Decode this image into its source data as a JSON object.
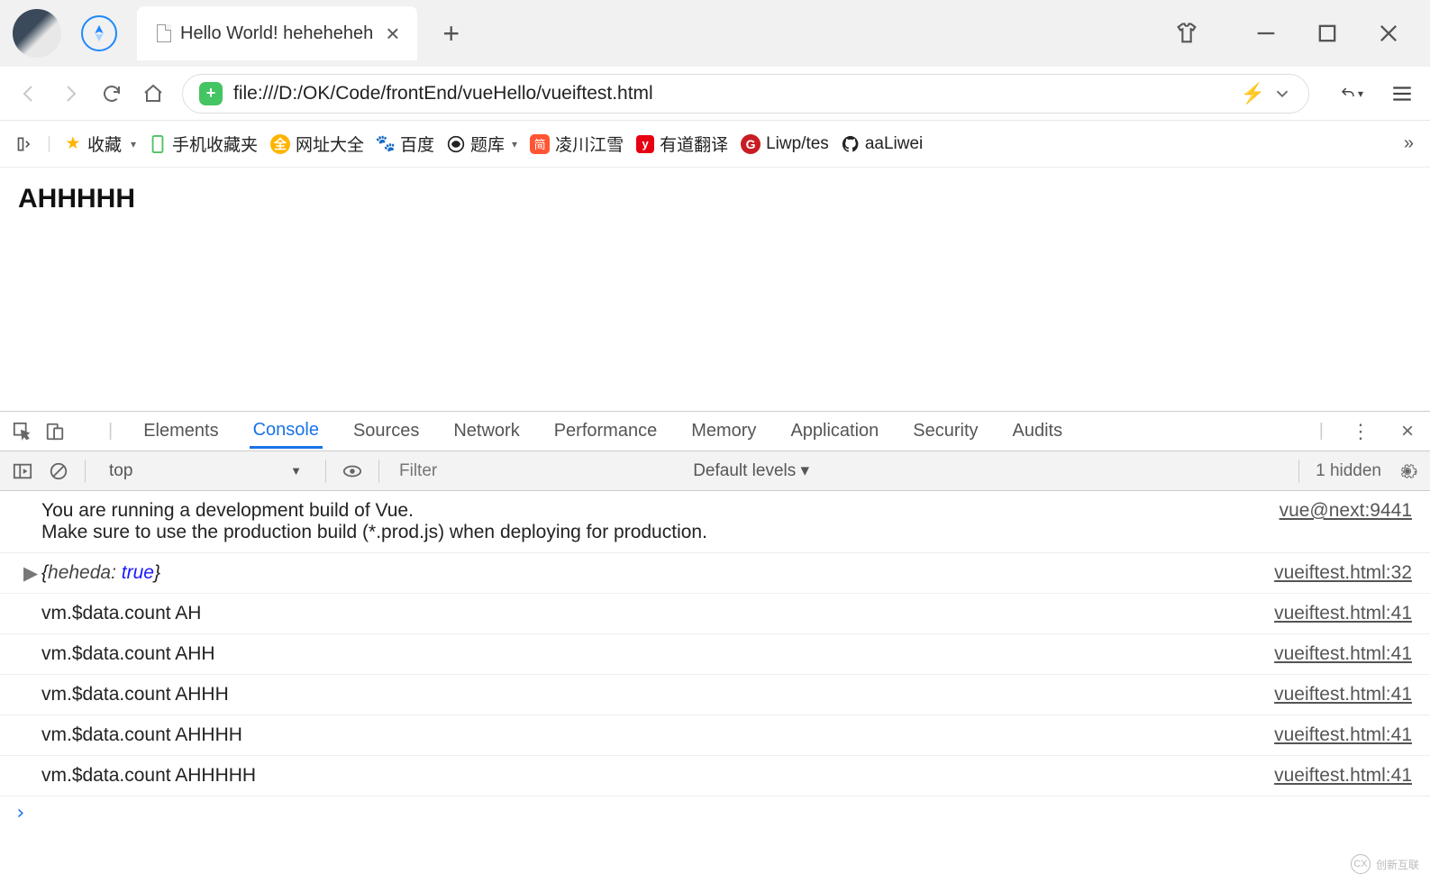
{
  "window": {
    "tab_title": "Hello World! heheheheh",
    "url": "file:///D:/OK/Code/frontEnd/vueHello/vueiftest.html"
  },
  "bookmarks": {
    "fav": "收藏",
    "mobile": "手机收藏夹",
    "nav": "网址大全",
    "baidu": "百度",
    "tiku": "题库",
    "ling": "凌川江雪",
    "youdao": "有道翻译",
    "liwp": "Liwp/tes",
    "aaliwei": "aaLiwei"
  },
  "page": {
    "heading": "AHHHHH"
  },
  "devtools": {
    "tabs": [
      "Elements",
      "Console",
      "Sources",
      "Network",
      "Performance",
      "Memory",
      "Application",
      "Security",
      "Audits"
    ],
    "active_tab": "Console",
    "context": "top",
    "filter_placeholder": "Filter",
    "levels": "Default levels ▾",
    "hidden_count": "1 hidden"
  },
  "console": {
    "warn_line1": "You are running a development build of Vue.",
    "warn_line2": "Make sure to use the production build (*.prod.js) when deploying for production.",
    "warn_src": "vue@next:9441",
    "obj_prefix": "{",
    "obj_key": "heheda:",
    "obj_val": "true",
    "obj_suffix": "}",
    "obj_src": "vueiftest.html:32",
    "rows": [
      {
        "msg": "vm.$data.count AH",
        "src": "vueiftest.html:41"
      },
      {
        "msg": "vm.$data.count AHH",
        "src": "vueiftest.html:41"
      },
      {
        "msg": "vm.$data.count AHHH",
        "src": "vueiftest.html:41"
      },
      {
        "msg": "vm.$data.count AHHHH",
        "src": "vueiftest.html:41"
      },
      {
        "msg": "vm.$data.count AHHHHH",
        "src": "vueiftest.html:41"
      }
    ]
  },
  "watermark": "创新互联"
}
